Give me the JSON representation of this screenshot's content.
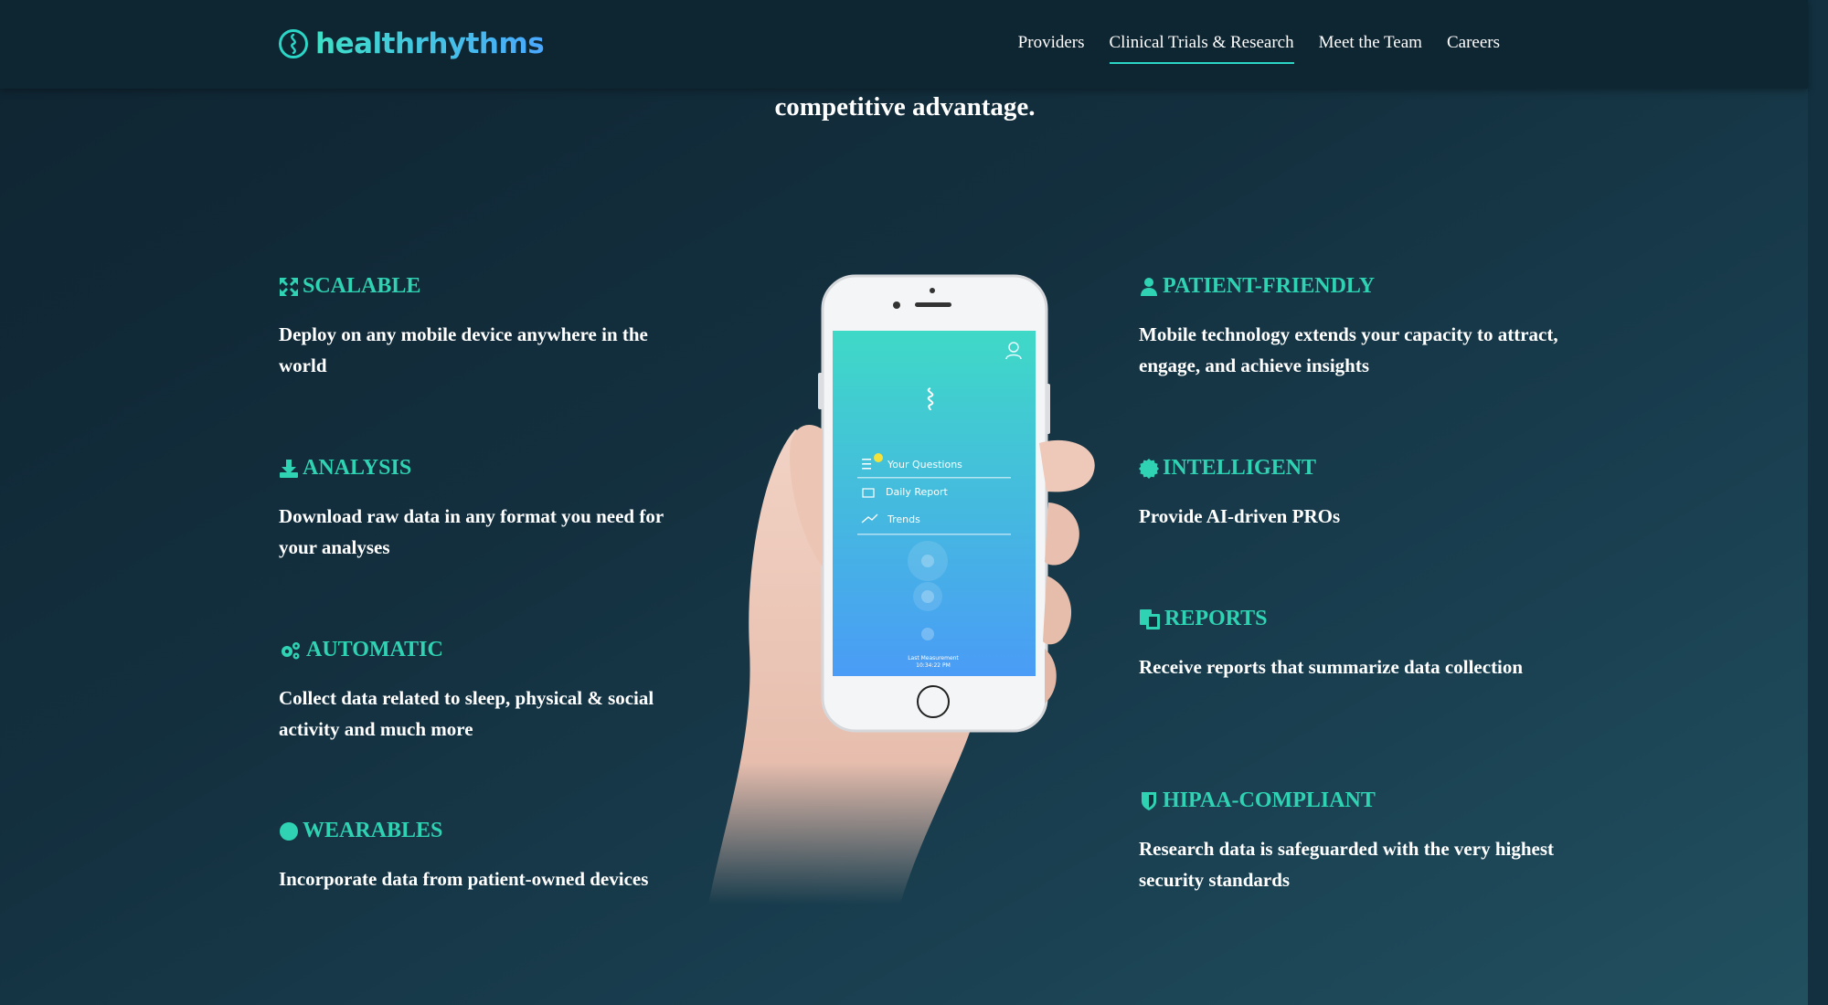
{
  "header": {
    "logo_text": "healthrhythms",
    "nav": [
      {
        "label": "Providers",
        "active": false
      },
      {
        "label": "Clinical Trials & Research",
        "active": true
      },
      {
        "label": "Meet the Team",
        "active": false
      },
      {
        "label": "Careers",
        "active": false
      }
    ]
  },
  "intro": {
    "line_partial": "its knowledge in clinical trial design, behavioral sensing, and novel research processes to enable you to gain a competitive advantage."
  },
  "features_left": [
    {
      "icon": "expand-icon",
      "title": "SCALABLE",
      "desc": "Deploy on any mobile device anywhere in the world"
    },
    {
      "icon": "download-icon",
      "title": "ANALYSIS",
      "desc": "Download raw data in any format you need for your analyses"
    },
    {
      "icon": "gears-icon",
      "title": "AUTOMATIC",
      "desc": "Collect data related to sleep, physical & social activity and much more"
    },
    {
      "icon": "circle-icon",
      "title": "WEARABLES",
      "desc": "Incorporate data from patient-owned devices"
    }
  ],
  "features_right": [
    {
      "icon": "user-icon",
      "title": "PATIENT-FRIENDLY",
      "desc": "Mobile technology extends your capacity to attract, engage, and achieve insights"
    },
    {
      "icon": "certificate-icon",
      "title": "INTELLIGENT",
      "desc": "Provide AI-driven PROs"
    },
    {
      "icon": "copy-icon",
      "title": "REPORTS",
      "desc": "Receive reports that summarize data collection"
    },
    {
      "icon": "shield-icon",
      "title": "HIPAA-COMPLIANT",
      "desc": "Research data is safeguarded with the very highest security standards"
    }
  ],
  "phone": {
    "menu": [
      "Your Questions",
      "Daily Report",
      "Trends"
    ],
    "footer_line1": "Last Measurement",
    "footer_line2": "10:34:22 PM"
  },
  "colors": {
    "accent": "#2fd3b3",
    "header_bg": "#0e2532",
    "page_bg": "#132f3e"
  }
}
